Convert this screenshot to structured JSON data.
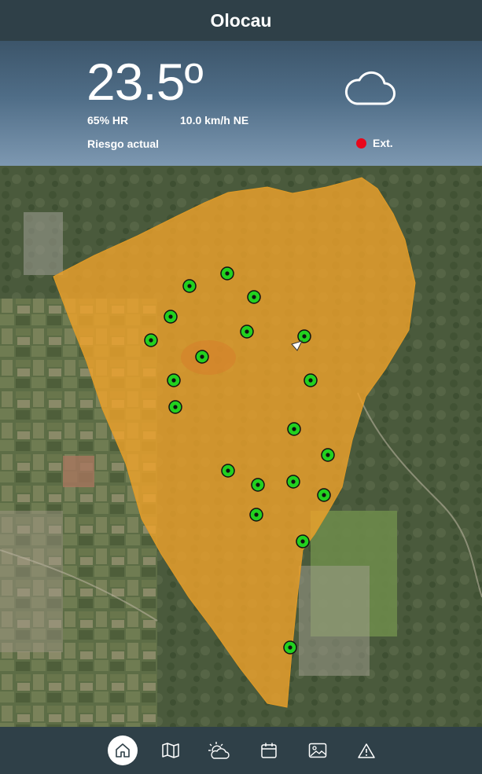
{
  "header": {
    "title": "Olocau"
  },
  "weather": {
    "temperature": "23.5º",
    "humidity": "65% HR",
    "wind": "10.0 km/h NE",
    "risk_label": "Riesgo actual",
    "risk_level_label": "Ext.",
    "risk_color": "#e8071b",
    "condition_icon": "cloud-icon"
  },
  "map": {
    "zone_color": "#f0a22a",
    "marker_color": "#22d11f",
    "marker_count": 20
  },
  "nav": {
    "items": [
      {
        "icon": "home-icon",
        "active": true
      },
      {
        "icon": "map-icon",
        "active": false
      },
      {
        "icon": "weather-sun-cloud-icon",
        "active": false
      },
      {
        "icon": "calendar-icon",
        "active": false
      },
      {
        "icon": "image-icon",
        "active": false
      },
      {
        "icon": "warning-icon",
        "active": false
      }
    ]
  }
}
